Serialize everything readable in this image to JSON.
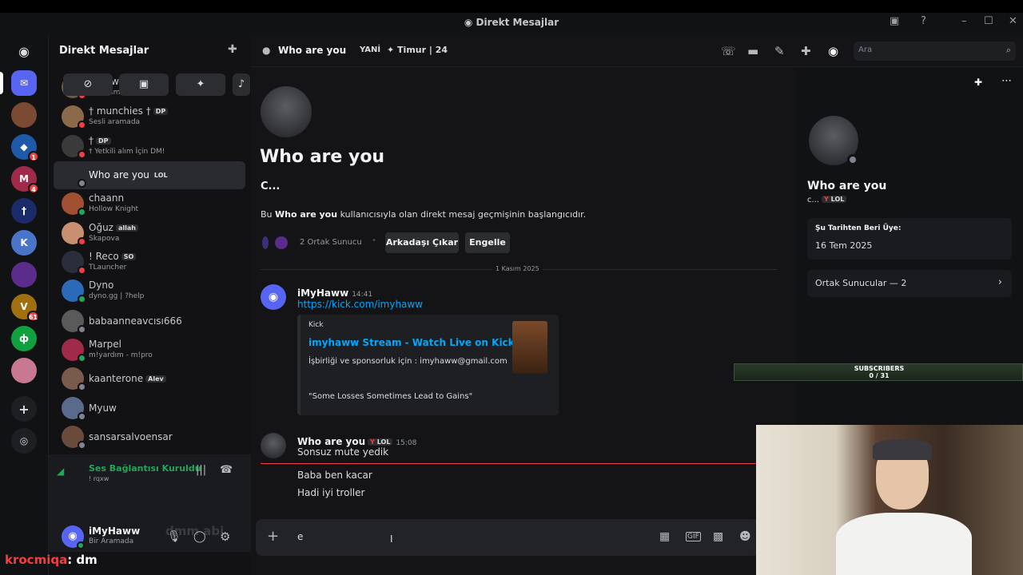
{
  "app": {
    "title": "Direkt Mesajlar"
  },
  "sidebar": {
    "title": "Direkt Mesajlar",
    "dms": [
      {
        "name": "! rqxw",
        "sub": "Bir Aramada",
        "tag": ""
      },
      {
        "name": "† munchies †",
        "sub": "Sesli aramada",
        "tag": "DP"
      },
      {
        "name": "†",
        "sub": "† Yetkili alım İçin DM!",
        "tag": "DP"
      },
      {
        "name": "Who are you",
        "sub": "",
        "tag": "LOL"
      },
      {
        "name": "chaann",
        "sub": "Hollow Knight",
        "tag": ""
      },
      {
        "name": "Oğuz",
        "sub": "Skapova",
        "tag": "allah"
      },
      {
        "name": "! Reco",
        "sub": "TLauncher",
        "tag": "SO"
      },
      {
        "name": "Dyno",
        "sub": "dyno.gg | ?help",
        "tag": ""
      },
      {
        "name": "babaanneavcısı666",
        "sub": "",
        "tag": ""
      },
      {
        "name": "Marpel",
        "sub": "m!yardım - m!pro",
        "tag": ""
      },
      {
        "name": "kaanterone",
        "sub": "",
        "tag": "Alev"
      },
      {
        "name": "Myuw",
        "sub": "",
        "tag": ""
      },
      {
        "name": "sansarsalvoensar",
        "sub": "",
        "tag": ""
      }
    ],
    "voice": {
      "status": "Ses Bağlantısı Kuruldu",
      "channel": "! rqxw"
    },
    "user": {
      "name": "iMyHaww",
      "status": "Bir Aramada"
    }
  },
  "rail": {
    "badges": [
      "1",
      "4",
      "1",
      "61"
    ]
  },
  "header": {
    "name": "Who are you",
    "note1": "YANİ",
    "note2": "✦ Timur | 24",
    "search_placeholder": "Ara"
  },
  "chat": {
    "intro_title": "Who are you",
    "intro_sub": "C...",
    "intro_text_pre": "Bu ",
    "intro_text_name": "Who are you",
    "intro_text_post": " kullanıcısıyla olan direkt mesaj geçmişinin başlangıcıdır.",
    "mutual_servers": "2 Ortak Sunucu",
    "remove_friend": "Arkadaşı Çıkar",
    "block": "Engelle",
    "date_divider": "1 Kasım 2025",
    "messages": [
      {
        "author": "iMyHaww",
        "time": "14:41",
        "text": "https://kick.com/imyhaww"
      },
      {
        "author": "Who are you",
        "tag": "LOL",
        "time": "15:08",
        "text": "Sonsuz mute yedik"
      }
    ],
    "embed": {
      "provider": "Kick",
      "title": "imyhaww Stream - Watch Live on Kick",
      "desc": "İşbirliği ve sponsorluk için : imyhaww@gmail.com",
      "quote": "\"Some Losses Sometimes Lead to Gains\""
    },
    "followups": [
      "Baba ben kacar",
      "Hadi iyi troller"
    ],
    "composer_value": "e"
  },
  "profile": {
    "name": "Who are you",
    "sub": "c...",
    "tag": "LOL",
    "member_since_label": "Şu Tarihten Beri Üye:",
    "member_since": "16 Tem 2025",
    "mutual_servers": "Ortak Sunucular — 2"
  },
  "overlay": {
    "subs_title": "SUBSCRIBERS",
    "subs_count": "0 / 31",
    "chat_user": "krocmiqa",
    "chat_text": ": dm",
    "ghost_text": "dmm abi"
  },
  "colors": {
    "accent": "#5865f2",
    "online": "#23a55a",
    "dnd": "#f23f43",
    "link": "#00a8fc"
  }
}
